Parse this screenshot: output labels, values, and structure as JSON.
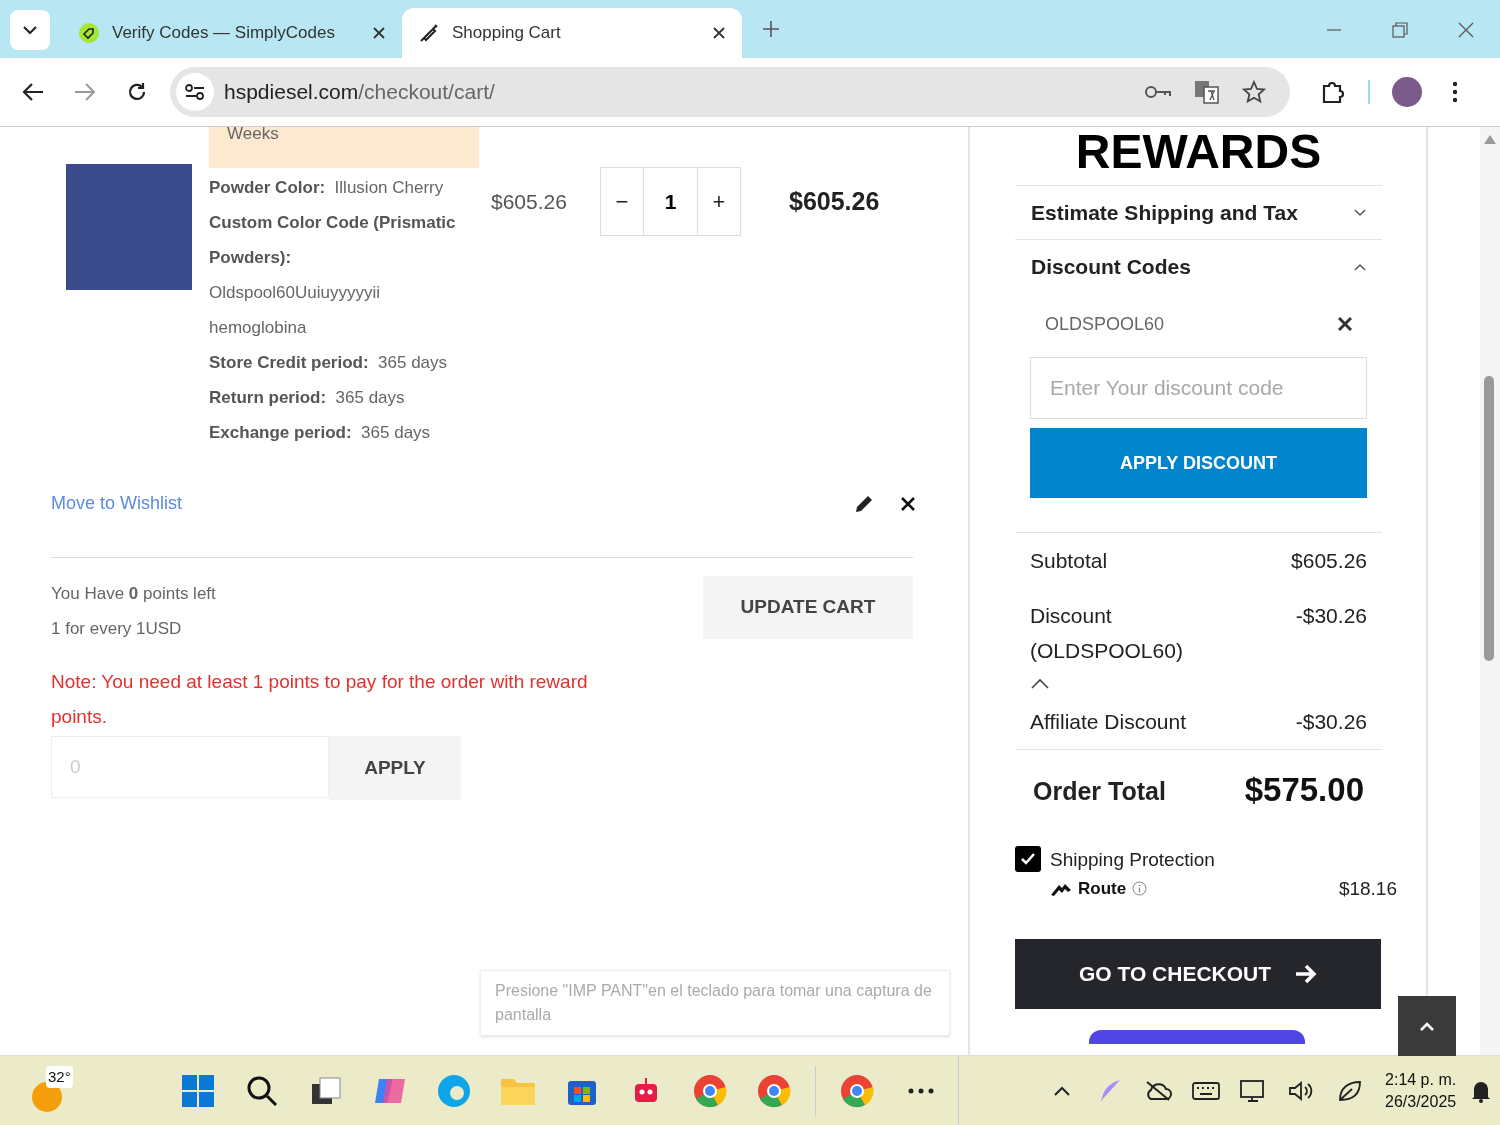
{
  "browser": {
    "tabs": [
      {
        "title": "Verify Codes — SimplyCodes",
        "selected": false
      },
      {
        "title": "Shopping Cart",
        "selected": true
      }
    ],
    "url_domain": "hspdiesel.com",
    "url_path": "/checkout/cart/"
  },
  "cart_item": {
    "stock_note": "Weeks",
    "options": [
      {
        "label": "Powder Color:",
        "value": "Illusion Cherry"
      },
      {
        "label": "Custom Color Code (Prismatic Powders):",
        "value": "Oldspool60Uuiuyyyyyii hemoglobina"
      },
      {
        "label": "Store Credit period:",
        "value": "365 days"
      },
      {
        "label": "Return period:",
        "value": "365 days"
      },
      {
        "label": "Exchange period:",
        "value": "365 days"
      }
    ],
    "price": "$605.26",
    "qty_minus": "−",
    "qty": "1",
    "qty_plus": "+",
    "subtotal": "$605.26",
    "wishlist_link": "Move to Wishlist"
  },
  "rewards": {
    "points_text": "You Have **0** points left",
    "rate": "1 for every 1USD",
    "note": "Note: You need at least 1 points to pay for the order with reward points.",
    "points_placeholder": "0",
    "apply_button": "APPLY"
  },
  "update_cart_button": "UPDATE CART",
  "summary": {
    "heading": "REWARDS",
    "sections": [
      {
        "title": "Estimate Shipping and Tax",
        "expanded": false
      },
      {
        "title": "Discount Codes",
        "expanded": true
      }
    ],
    "applied_code": "OLDSPOOL60",
    "code_placeholder": "Enter Your discount code",
    "apply_discount_button": "APPLY DISCOUNT",
    "rows": [
      {
        "label": "Subtotal",
        "value": "$605.26"
      },
      {
        "label": "Discount (OLDSPOOL60)",
        "value": "-$30.26"
      },
      {
        "label": "Affiliate Discount",
        "value": "-$30.26"
      }
    ],
    "total_label": "Order Total",
    "total_value": "$575.00",
    "protection": {
      "checked": true,
      "label": "Shipping Protection",
      "brand": "Route",
      "price": "$18.16"
    },
    "checkout_button": "GO TO CHECKOUT"
  },
  "toast": "Presione \"IMP PANT\"en el teclado para tomar una captura de pantalla",
  "taskbar": {
    "temperature": "32°",
    "time": "2:14 p. m.",
    "date": "26/3/2025"
  }
}
